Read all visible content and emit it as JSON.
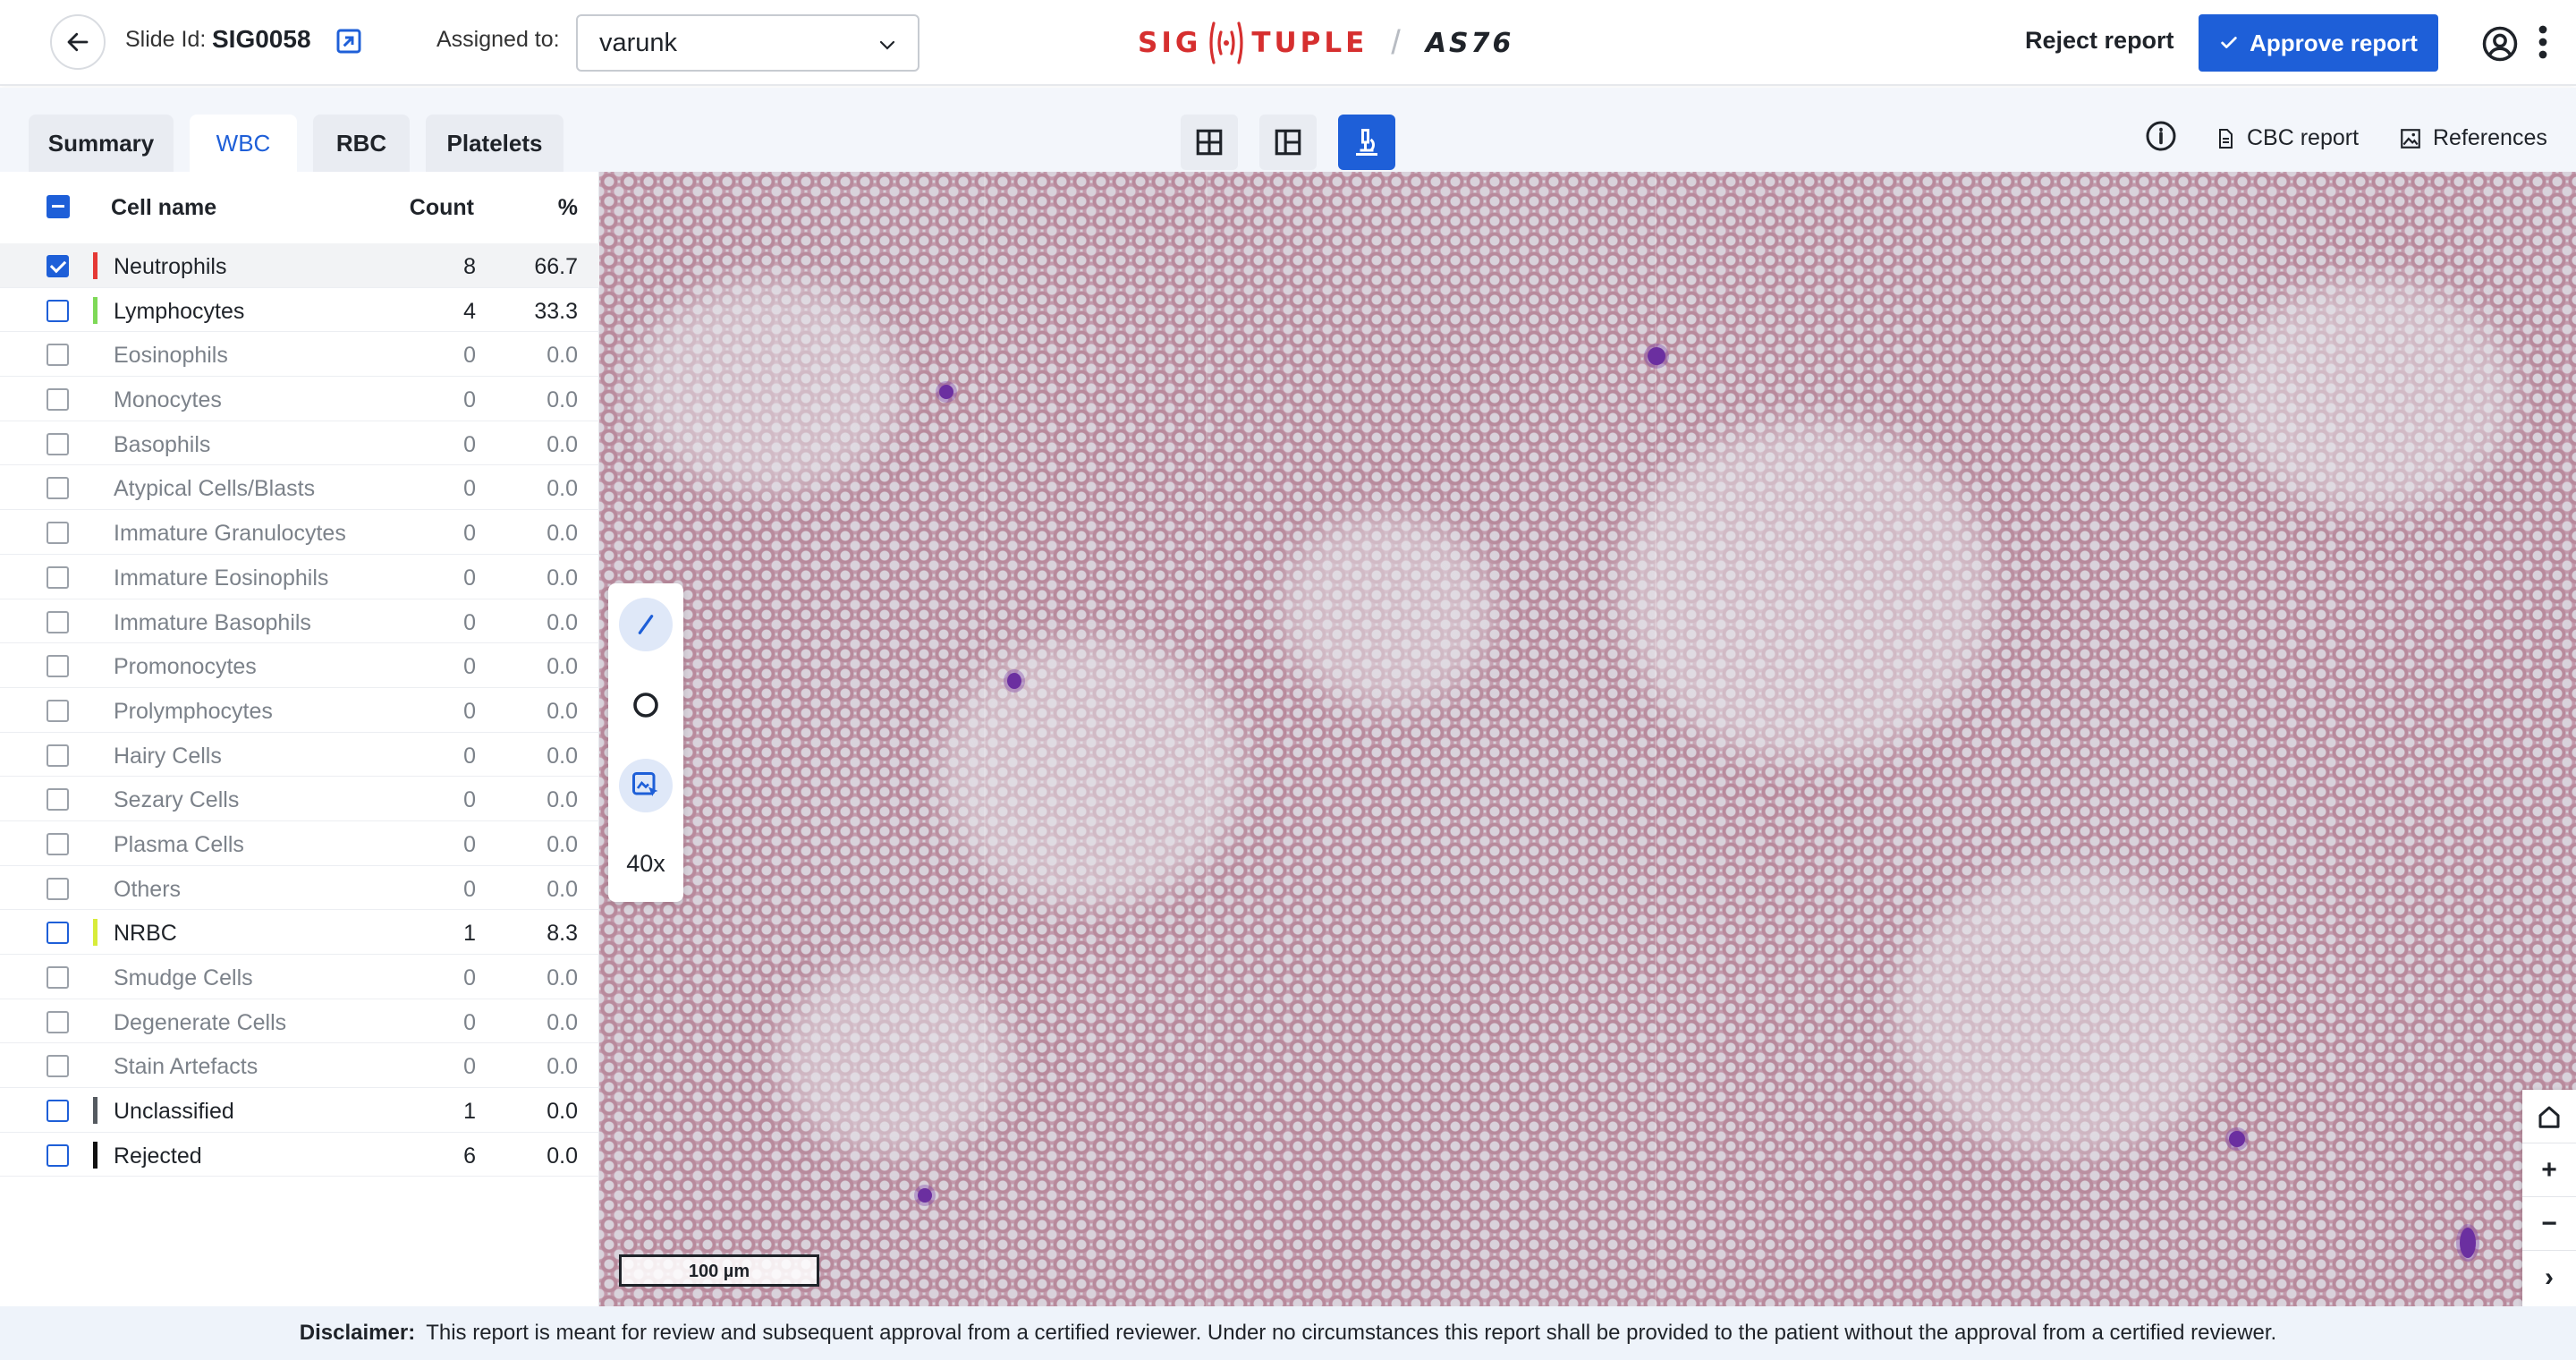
{
  "header": {
    "slide_label": "Slide Id:",
    "slide_id": "SIG0058",
    "assigned_label": "Assigned to:",
    "assigned_value": "varunk",
    "logo_left": "SIG",
    "logo_right": "TUPLE",
    "logo_separator": "/",
    "logo_product": "AS76",
    "reject_label": "Reject report",
    "approve_label": "Approve report",
    "brand_red": "#d62f2f",
    "accent_blue": "#1e5fd8"
  },
  "tabs": [
    {
      "label": "Summary",
      "active": false
    },
    {
      "label": "WBC",
      "active": true
    },
    {
      "label": "RBC",
      "active": false
    },
    {
      "label": "Platelets",
      "active": false
    }
  ],
  "view_buttons": [
    {
      "icon": "grid-four-icon",
      "active": false
    },
    {
      "icon": "grid-three-icon",
      "active": false
    },
    {
      "icon": "microscope-icon",
      "active": true
    }
  ],
  "top_links": {
    "info_icon": "info-icon",
    "cbc_report": "CBC report",
    "references": "References"
  },
  "table": {
    "headers": {
      "name": "Cell name",
      "count": "Count",
      "pct": "%"
    },
    "rows": [
      {
        "name": "Neutrophils",
        "count": "8",
        "pct": "66.7",
        "color": "#e53935",
        "state": "checked",
        "active": true
      },
      {
        "name": "Lymphocytes",
        "count": "4",
        "pct": "33.3",
        "color": "#7ed957",
        "state": "blue",
        "active": true
      },
      {
        "name": "Eosinophils",
        "count": "0",
        "pct": "0.0",
        "color": "",
        "state": "empty",
        "active": false
      },
      {
        "name": "Monocytes",
        "count": "0",
        "pct": "0.0",
        "color": "",
        "state": "empty",
        "active": false
      },
      {
        "name": "Basophils",
        "count": "0",
        "pct": "0.0",
        "color": "",
        "state": "empty",
        "active": false
      },
      {
        "name": "Atypical Cells/Blasts",
        "count": "0",
        "pct": "0.0",
        "color": "",
        "state": "empty",
        "active": false
      },
      {
        "name": "Immature Granulocytes",
        "count": "0",
        "pct": "0.0",
        "color": "",
        "state": "empty",
        "active": false
      },
      {
        "name": "Immature Eosinophils",
        "count": "0",
        "pct": "0.0",
        "color": "",
        "state": "empty",
        "active": false
      },
      {
        "name": "Immature Basophils",
        "count": "0",
        "pct": "0.0",
        "color": "",
        "state": "empty",
        "active": false
      },
      {
        "name": "Promonocytes",
        "count": "0",
        "pct": "0.0",
        "color": "",
        "state": "empty",
        "active": false
      },
      {
        "name": "Prolymphocytes",
        "count": "0",
        "pct": "0.0",
        "color": "",
        "state": "empty",
        "active": false
      },
      {
        "name": "Hairy Cells",
        "count": "0",
        "pct": "0.0",
        "color": "",
        "state": "empty",
        "active": false
      },
      {
        "name": "Sezary Cells",
        "count": "0",
        "pct": "0.0",
        "color": "",
        "state": "empty",
        "active": false
      },
      {
        "name": "Plasma Cells",
        "count": "0",
        "pct": "0.0",
        "color": "",
        "state": "empty",
        "active": false
      },
      {
        "name": "Others",
        "count": "0",
        "pct": "0.0",
        "color": "",
        "state": "empty",
        "active": false
      },
      {
        "name": "NRBC",
        "count": "1",
        "pct": "8.3",
        "color": "#d8ec3a",
        "state": "blue",
        "active": true
      },
      {
        "name": "Smudge Cells",
        "count": "0",
        "pct": "0.0",
        "color": "",
        "state": "empty",
        "active": false
      },
      {
        "name": "Degenerate Cells",
        "count": "0",
        "pct": "0.0",
        "color": "",
        "state": "empty",
        "active": false
      },
      {
        "name": "Stain Artefacts",
        "count": "0",
        "pct": "0.0",
        "color": "",
        "state": "empty",
        "active": false
      },
      {
        "name": "Unclassified",
        "count": "1",
        "pct": "0.0",
        "color": "#555a60",
        "state": "blue",
        "active": true
      },
      {
        "name": "Rejected",
        "count": "6",
        "pct": "0.0",
        "color": "#111111",
        "state": "blue",
        "active": true
      }
    ]
  },
  "viewer": {
    "tools": [
      "line-tool-icon",
      "circle-tool-icon",
      "select-area-icon"
    ],
    "zoom": "40x",
    "scale_label": "100 µm",
    "nav": [
      "home-icon",
      "+",
      "−",
      "›"
    ]
  },
  "disclaimer": {
    "label": "Disclaimer:",
    "text": "This report is meant for review and subsequent approval from a certified reviewer. Under no circumstances this report shall be provided to the patient without the approval from a certified reviewer."
  }
}
